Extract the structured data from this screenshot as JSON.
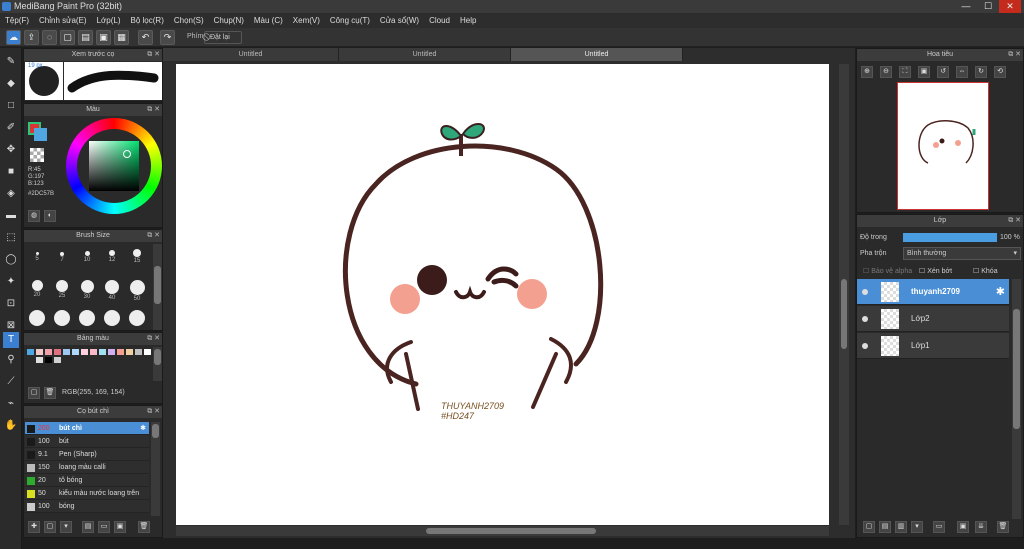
{
  "app": {
    "title": "MediBang Paint Pro (32bit)",
    "win_min": "—",
    "win_max": "☐",
    "win_close": "✕"
  },
  "menu": [
    "Tệp(F)",
    "Chỉnh sửa(E)",
    "Lớp(L)",
    "Bộ lọc(R)",
    "Chọn(S)",
    "Chụp(N)",
    "Màu (C)",
    "Xem(V)",
    "Công cụ(T)",
    "Cửa sổ(W)",
    "Cloud",
    "Help"
  ],
  "toolbar": {
    "snap_label": "Phím",
    "reset_label": "Đặt lại"
  },
  "brush_preview": {
    "title": "Xem trước cọ",
    "size_label": "19 px"
  },
  "color": {
    "title": "Màu",
    "r": "R:45",
    "g": "G:197",
    "b": "B:123",
    "hex": "#2DC57B",
    "fg": "#2DC57B",
    "bg": "#4fa6e0"
  },
  "brush_size": {
    "title": "Brush Size",
    "sizes": [
      "5",
      "7",
      "10",
      "12",
      "15",
      "20",
      "25",
      "30",
      "40",
      "50"
    ]
  },
  "palette": {
    "title": "Bảng màu",
    "rgb_label": "RGB(255, 169, 154)"
  },
  "pens": {
    "title": "Cọ bút chì",
    "items": [
      {
        "size": "200",
        "name": "bút chì",
        "color": "#1a1a1a",
        "selected": true
      },
      {
        "size": "100",
        "name": "bút",
        "color": "#1a1a1a"
      },
      {
        "size": "9.1",
        "name": "Pen (Sharp)",
        "color": "#1a1a1a"
      },
      {
        "size": "150",
        "name": "loang màu calli",
        "color": "#bbbbbb"
      },
      {
        "size": "20",
        "name": "tô bóng",
        "color": "#2eaa2e"
      },
      {
        "size": "50",
        "name": "kiểu màu nước loang trên",
        "color": "#d8e020"
      },
      {
        "size": "100",
        "name": "bóng",
        "color": "#cccccc"
      }
    ]
  },
  "tabs": [
    "Untitled",
    "Untitled",
    "Untitled"
  ],
  "navigator": {
    "title": "Hoa tiêu"
  },
  "layers": {
    "title": "Lớp",
    "opacity_label": "Độ trong",
    "opacity_value": "100 %",
    "blend_label": "Pha trộn",
    "blend_value": "Bình thường",
    "protect_alpha": "Bảo vệ alpha",
    "clipping": "Xén bớt",
    "lock": "Khóa",
    "items": [
      {
        "name": "thuyanh2709",
        "selected": true
      },
      {
        "name": "Lớp2"
      },
      {
        "name": "Lớp1"
      }
    ]
  },
  "canvas": {
    "signature_line1": "THUYANH2709",
    "signature_line2": "#HD247"
  }
}
